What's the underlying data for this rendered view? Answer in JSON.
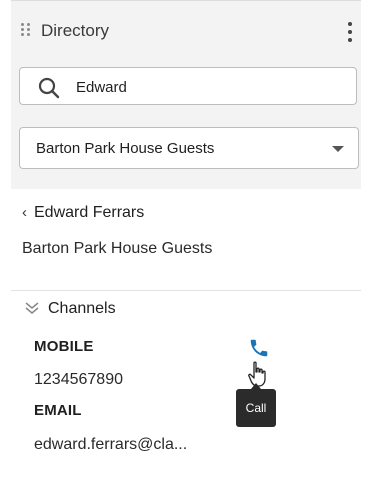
{
  "header": {
    "title": "Directory"
  },
  "search": {
    "value": "Edward",
    "placeholder": ""
  },
  "filter": {
    "selected": "Barton Park House Guests"
  },
  "contact": {
    "name": "Edward Ferrars",
    "group": "Barton Park House Guests"
  },
  "channels": {
    "label": "Channels",
    "mobile_label": "MOBILE",
    "mobile_value": "1234567890",
    "email_label": "EMAIL",
    "email_value": "edward.ferrars@cla..."
  },
  "tooltip": {
    "text": "Call"
  },
  "colors": {
    "accent": "#1a73b5",
    "tooltip_bg": "#2b2b2b",
    "panel_bg": "#f3f3f3"
  },
  "icons": [
    "drag-grip-icon",
    "more-vertical-icon",
    "search-icon",
    "chevron-down-icon",
    "back-chevron-icon",
    "double-chevron-down-icon",
    "phone-icon",
    "hand-cursor-icon"
  ]
}
